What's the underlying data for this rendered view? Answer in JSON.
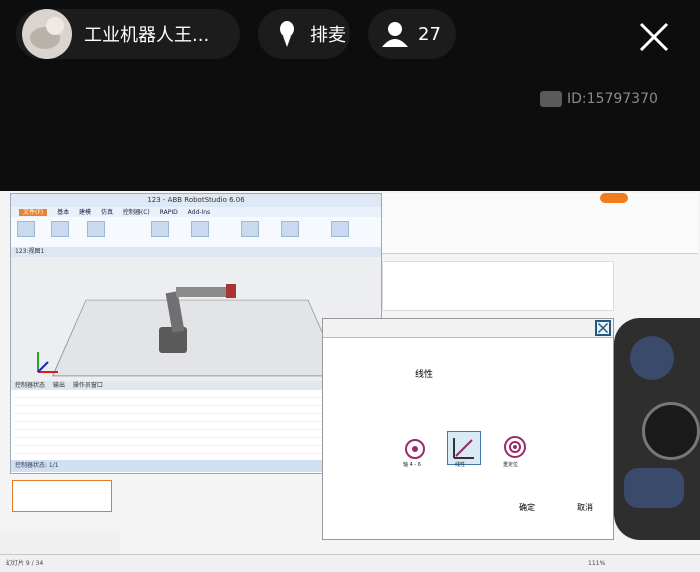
{
  "live": {
    "host_name": "工业机器人王...",
    "mic_label": "排麦",
    "viewer_count": "27",
    "room_id": "ID:15797370",
    "icons": {
      "mic": "mic-icon",
      "user": "user-icon",
      "close": "close-icon",
      "camera": "camera-icon"
    }
  },
  "robotstudio": {
    "window_title": "123 - ABB RobotStudio 6.06",
    "tabs": [
      "文件(F)",
      "基本",
      "建模",
      "仿真",
      "控制器(C)",
      "RAPID",
      "Add-Ins"
    ],
    "view_tab": "123:视图1",
    "output_tabs": [
      "控制器状态",
      "输出",
      "操作员窗口"
    ],
    "status_text": "控制器状态: 1/1"
  },
  "flexpendant": {
    "mode_label": "线性",
    "axis_label": "轴 4 - 6",
    "selected_label": "线性",
    "reorient_label": "重定位",
    "ok_label": "确定",
    "cancel_label": "取消"
  },
  "ppt": {
    "slide_indicator": "幻灯片 9 / 34",
    "zoom": "111%"
  }
}
